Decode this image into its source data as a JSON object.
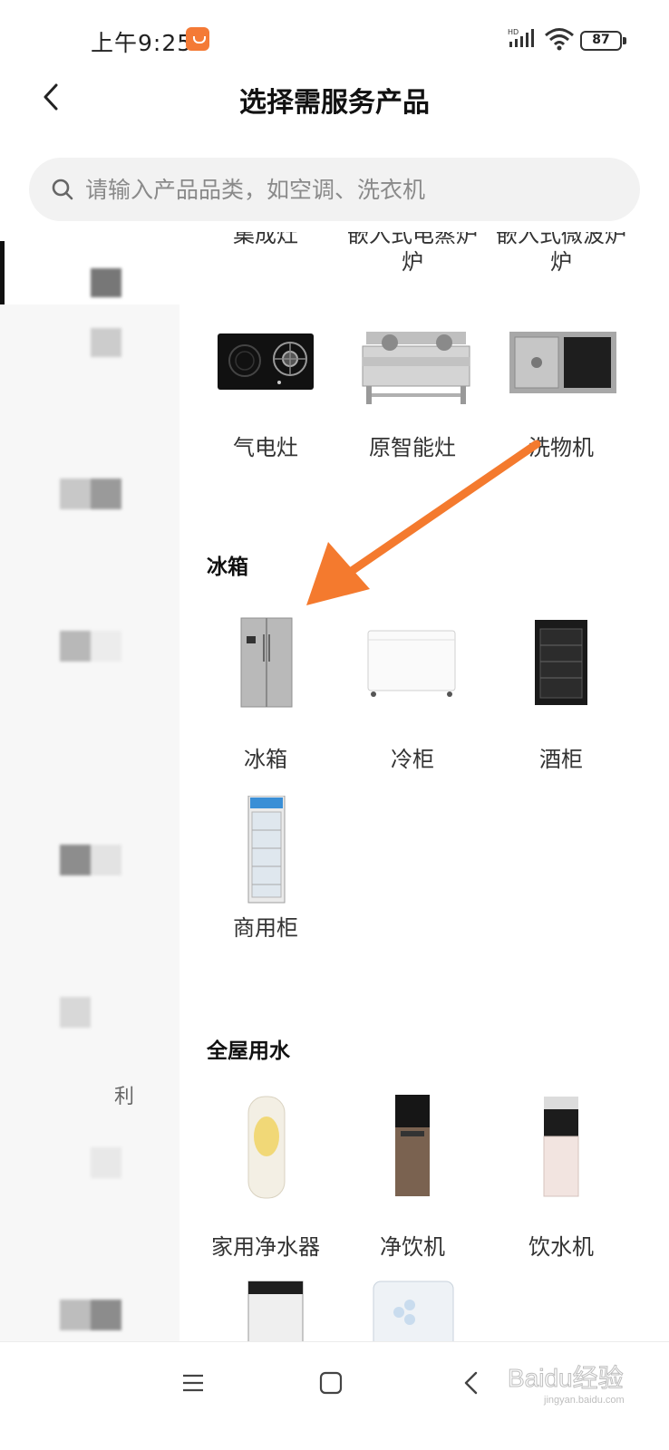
{
  "status_bar": {
    "time": "上午9:25",
    "battery": "87",
    "signal_label": "HD"
  },
  "header": {
    "title": "选择需服务产品"
  },
  "search": {
    "placeholder": "请输入产品品类，如空调、洗衣机"
  },
  "sidebar": {
    "visible_label": "利"
  },
  "partial_row": {
    "items": [
      "集成灶",
      "嵌入式电蒸炉",
      "嵌入式微波炉"
    ],
    "item2_visible": "炉",
    "item3_visible": "炉"
  },
  "stove_row": {
    "items": [
      "气电灶",
      "原智能灶",
      "洗物机"
    ]
  },
  "sections": [
    {
      "title": "冰箱",
      "items": [
        "冰箱",
        "冷柜",
        "酒柜",
        "商用柜"
      ]
    },
    {
      "title": "全屋用水",
      "items": [
        "家用净水器",
        "净饮机",
        "饮水机"
      ]
    }
  ],
  "colors": {
    "accent_arrow": "#f47a2e",
    "search_bg": "#f2f2f2",
    "sidebar_bg": "#f7f7f7"
  },
  "icons": [
    "back-arrow-icon",
    "search-icon",
    "menu-icon",
    "home-icon",
    "nav-back-icon"
  ],
  "watermark": {
    "text": "Baidu经验",
    "subtext": "jingyan.baidu.com"
  }
}
